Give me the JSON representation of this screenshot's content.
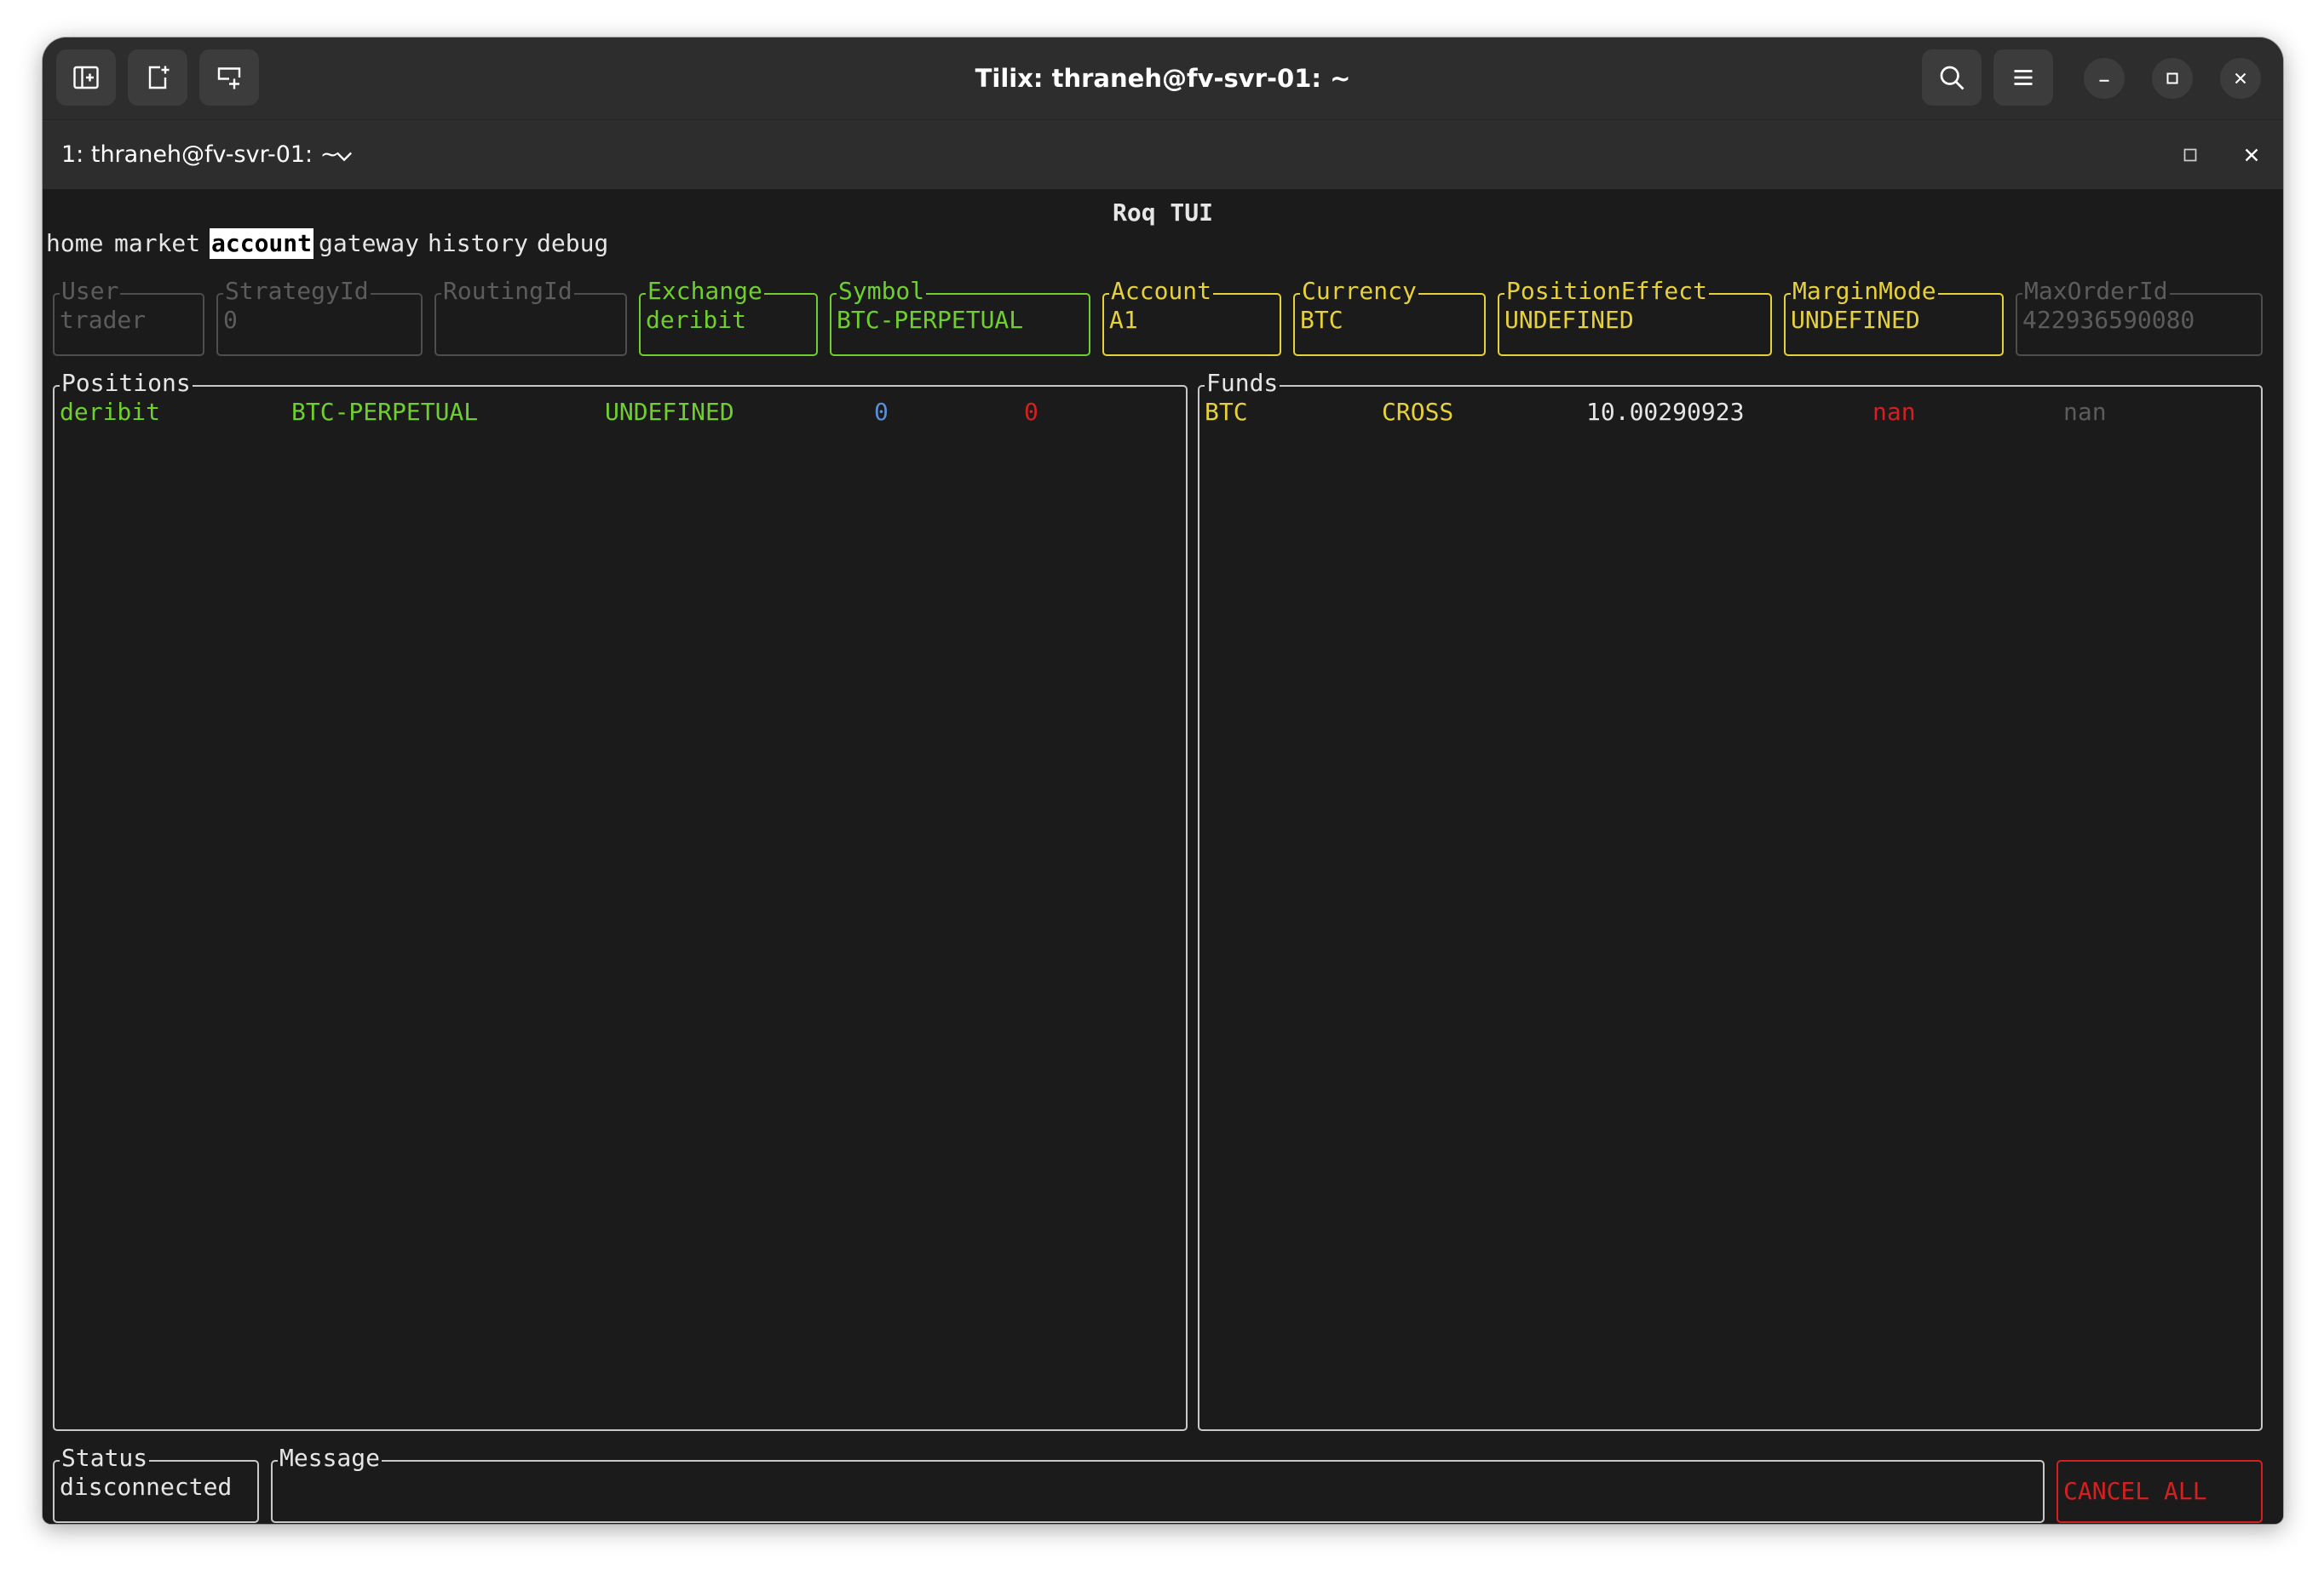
{
  "window": {
    "title": "Tilix: thraneh@fv-svr-01: ~",
    "tab_title": "1: thraneh@fv-svr-01: ~"
  },
  "tui": {
    "title": "Roq TUI",
    "menu": [
      {
        "label": "home"
      },
      {
        "label": "market"
      },
      {
        "label": "account"
      },
      {
        "label": "gateway"
      },
      {
        "label": "history"
      },
      {
        "label": "debug"
      }
    ],
    "fields": {
      "user": {
        "label": "User",
        "value": "trader"
      },
      "strategy_id": {
        "label": "StrategyId",
        "value": "0"
      },
      "routing_id": {
        "label": "RoutingId",
        "value": ""
      },
      "exchange": {
        "label": "Exchange",
        "value": "deribit"
      },
      "symbol": {
        "label": "Symbol",
        "value": "BTC-PERPETUAL"
      },
      "account": {
        "label": "Account",
        "value": "A1"
      },
      "currency": {
        "label": "Currency",
        "value": "BTC"
      },
      "position_effect": {
        "label": "PositionEffect",
        "value": "UNDEFINED"
      },
      "margin_mode": {
        "label": "MarginMode",
        "value": "UNDEFINED"
      },
      "max_order_id": {
        "label": "MaxOrderId",
        "value": "422936590080"
      }
    },
    "positions": {
      "label": "Positions",
      "rows": [
        {
          "exchange": "deribit",
          "symbol": "BTC-PERPETUAL",
          "effect": "UNDEFINED",
          "long": "0",
          "short": "0"
        }
      ]
    },
    "funds": {
      "label": "Funds",
      "rows": [
        {
          "currency": "BTC",
          "margin_mode": "CROSS",
          "balance": "10.00290923",
          "hold": "nan",
          "external": "nan"
        }
      ]
    },
    "status": {
      "label": "Status",
      "value": "disconnected"
    },
    "message": {
      "label": "Message",
      "value": ""
    },
    "cancel_all": "CANCEL ALL"
  },
  "colors": {
    "active": "#6fcf2f",
    "editable": "#e7d13a",
    "disabled": "#5c5c5c",
    "alert": "#d42020",
    "numeric": "#5a8fd6",
    "terminal_bg": "#1b1b1b",
    "titlebar_bg": "#2d2d2d"
  },
  "icons": {
    "titlebar_left": [
      "add-terminal-icon",
      "split-right-icon",
      "split-down-icon"
    ],
    "titlebar_right": [
      "search-icon",
      "hamburger-menu-icon",
      "minimize-icon",
      "maximize-icon",
      "close-icon"
    ]
  }
}
